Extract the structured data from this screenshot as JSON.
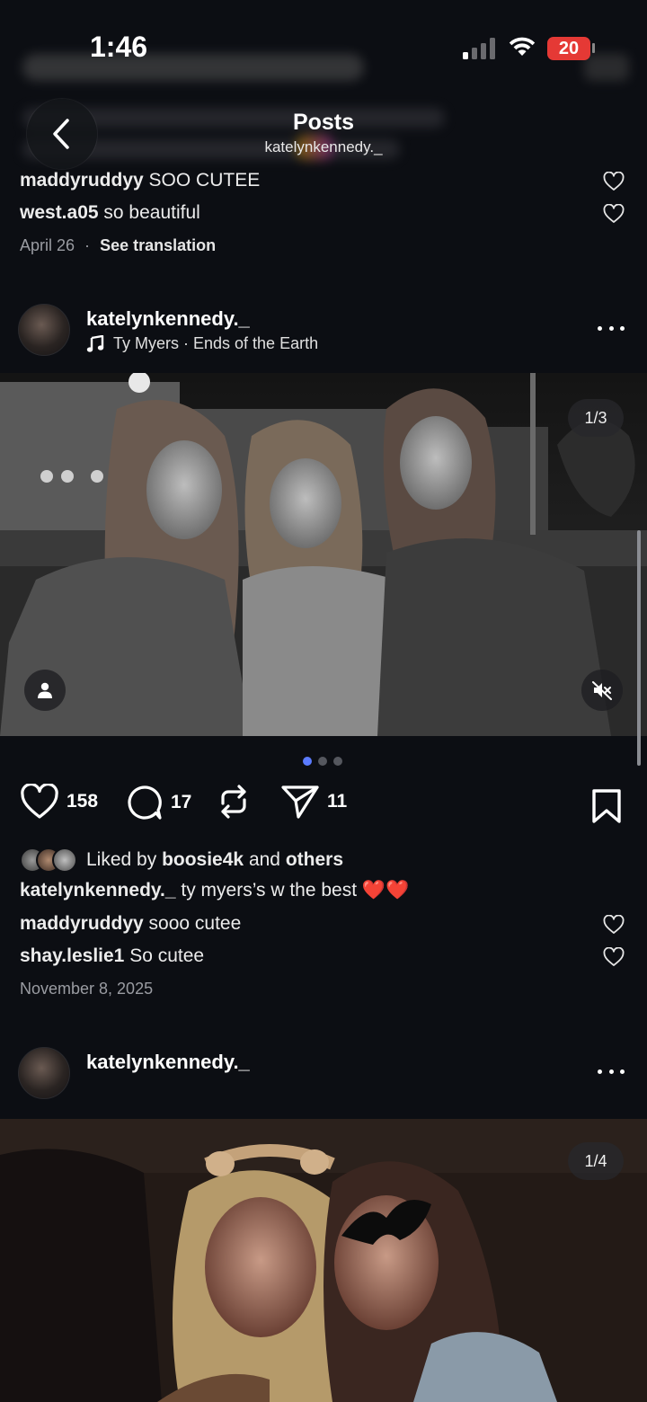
{
  "status": {
    "time": "1:46",
    "battery": "20"
  },
  "nav": {
    "title": "Posts",
    "subtitle": "katelynkennedy._"
  },
  "prev_post": {
    "comments": [
      {
        "user": "maddyruddyy",
        "text": "SOO CUTEE"
      },
      {
        "user": "west.a05",
        "text": "so beautiful"
      }
    ],
    "date": "April 26",
    "separator": "·",
    "see_translation": "See translation"
  },
  "post1": {
    "username": "katelynkennedy._",
    "music": "Ty Myers · Ends of the Earth",
    "counter": "1/3",
    "likes": "158",
    "comments_count": "17",
    "shares": "11",
    "liked_by_prefix": "Liked by",
    "liked_by_user": "boosie4k",
    "liked_by_and": "and",
    "liked_by_others": "others",
    "caption_user": "katelynkennedy._",
    "caption_text": "ty myers’s w the best ❤️❤️",
    "comments": [
      {
        "user": "maddyruddyy",
        "text": "sooo cutee"
      },
      {
        "user": "shay.leslie1",
        "text": "So cutee"
      }
    ],
    "date": "November 8, 2025"
  },
  "post2": {
    "username": "katelynkennedy._",
    "counter": "1/4"
  },
  "colors": {
    "background": "#0c0e13",
    "active_dot": "#5b7bff",
    "battery": "#e53935",
    "heart_red": "#e0312f"
  }
}
